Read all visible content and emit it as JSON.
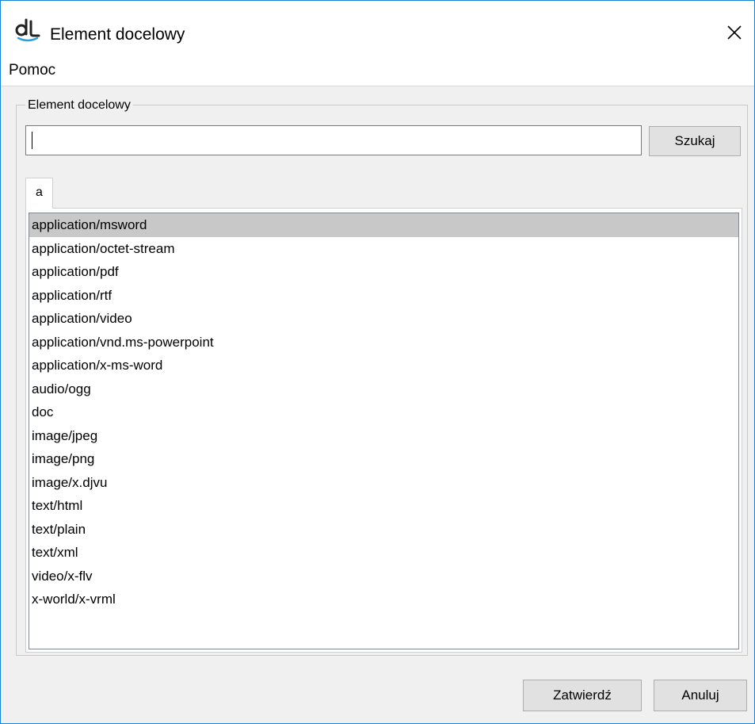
{
  "window": {
    "title": "Element docelowy",
    "accent_color": "#1883d7",
    "icon": "app-logo-icon"
  },
  "menubar": {
    "items": [
      {
        "label": "Pomoc"
      }
    ]
  },
  "group": {
    "legend": "Element docelowy"
  },
  "search": {
    "value": "",
    "button_label": "Szukaj"
  },
  "tabs": [
    {
      "label": "a",
      "selected": true
    }
  ],
  "list": {
    "selected_index": 0,
    "items": [
      "application/msword",
      "application/octet-stream",
      "application/pdf",
      "application/rtf",
      "application/video",
      "application/vnd.ms-powerpoint",
      "application/x-ms-word",
      "audio/ogg",
      "doc",
      "image/jpeg",
      "image/png",
      "image/x.djvu",
      "text/html",
      "text/plain",
      "text/xml",
      "video/x-flv",
      "x-world/x-vrml"
    ]
  },
  "footer": {
    "ok_label": "Zatwierdź",
    "cancel_label": "Anuluj"
  }
}
